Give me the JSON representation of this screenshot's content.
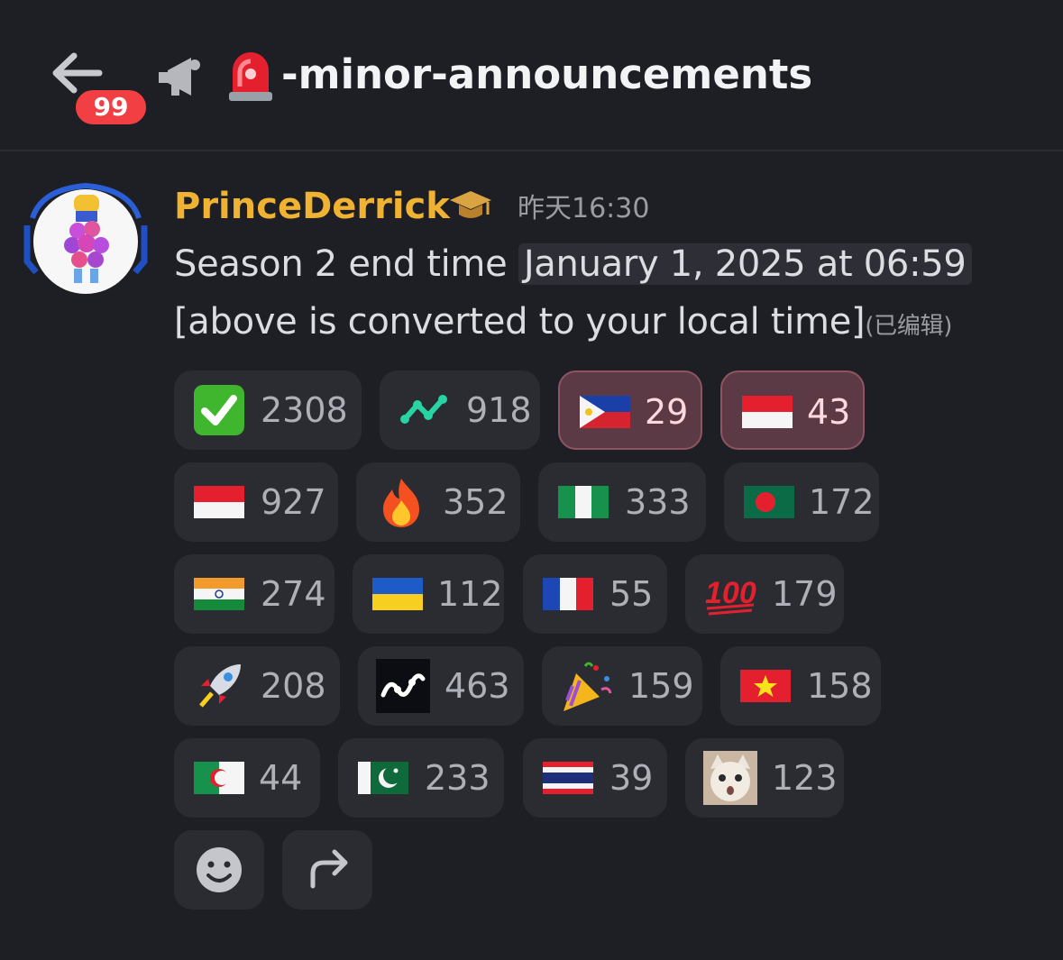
{
  "header": {
    "unread_count": "99",
    "channel_name": "-minor-announcements"
  },
  "message": {
    "author": "PrinceDerrick",
    "timestamp": "昨天16:30",
    "text_prefix": "Season 2 end time ",
    "time_chip": "January 1, 2025 at 06:59",
    "text_line2": "[above is converted to your local time]",
    "edited_label": "(已编辑)"
  },
  "reactions": [
    {
      "icon": "check-mark-icon",
      "count": "2308"
    },
    {
      "icon": "network-icon",
      "count": "918"
    },
    {
      "icon": "philippines-flag-icon",
      "count": "29",
      "active": true
    },
    {
      "icon": "indonesia-flag-icon",
      "count": "43",
      "active": true
    },
    {
      "icon": "indonesia-flag-icon",
      "count": "927"
    },
    {
      "icon": "fire-icon",
      "count": "352"
    },
    {
      "icon": "nigeria-flag-icon",
      "count": "333"
    },
    {
      "icon": "bangladesh-flag-icon",
      "count": "172"
    },
    {
      "icon": "india-flag-icon",
      "count": "274"
    },
    {
      "icon": "ukraine-flag-icon",
      "count": "112"
    },
    {
      "icon": "france-flag-icon",
      "count": "55"
    },
    {
      "icon": "hundred-points-icon",
      "count": "179"
    },
    {
      "icon": "rocket-icon",
      "count": "208"
    },
    {
      "icon": "nano-logo-icon",
      "count": "463"
    },
    {
      "icon": "party-popper-icon",
      "count": "159"
    },
    {
      "icon": "vietnam-flag-icon",
      "count": "158"
    },
    {
      "icon": "algeria-flag-icon",
      "count": "44"
    },
    {
      "icon": "pakistan-flag-icon",
      "count": "233"
    },
    {
      "icon": "thailand-flag-icon",
      "count": "39"
    },
    {
      "icon": "cat-face-icon",
      "count": "123"
    }
  ],
  "actions": [
    {
      "icon": "add-reaction-smiley-icon"
    },
    {
      "icon": "share-arrow-icon"
    }
  ],
  "colors": {
    "background": "#1e1f24",
    "author": "#f0b232",
    "badge": "#f23f43",
    "reaction_bg": "#2b2c32",
    "reaction_active_bg": "#5c3a45"
  }
}
